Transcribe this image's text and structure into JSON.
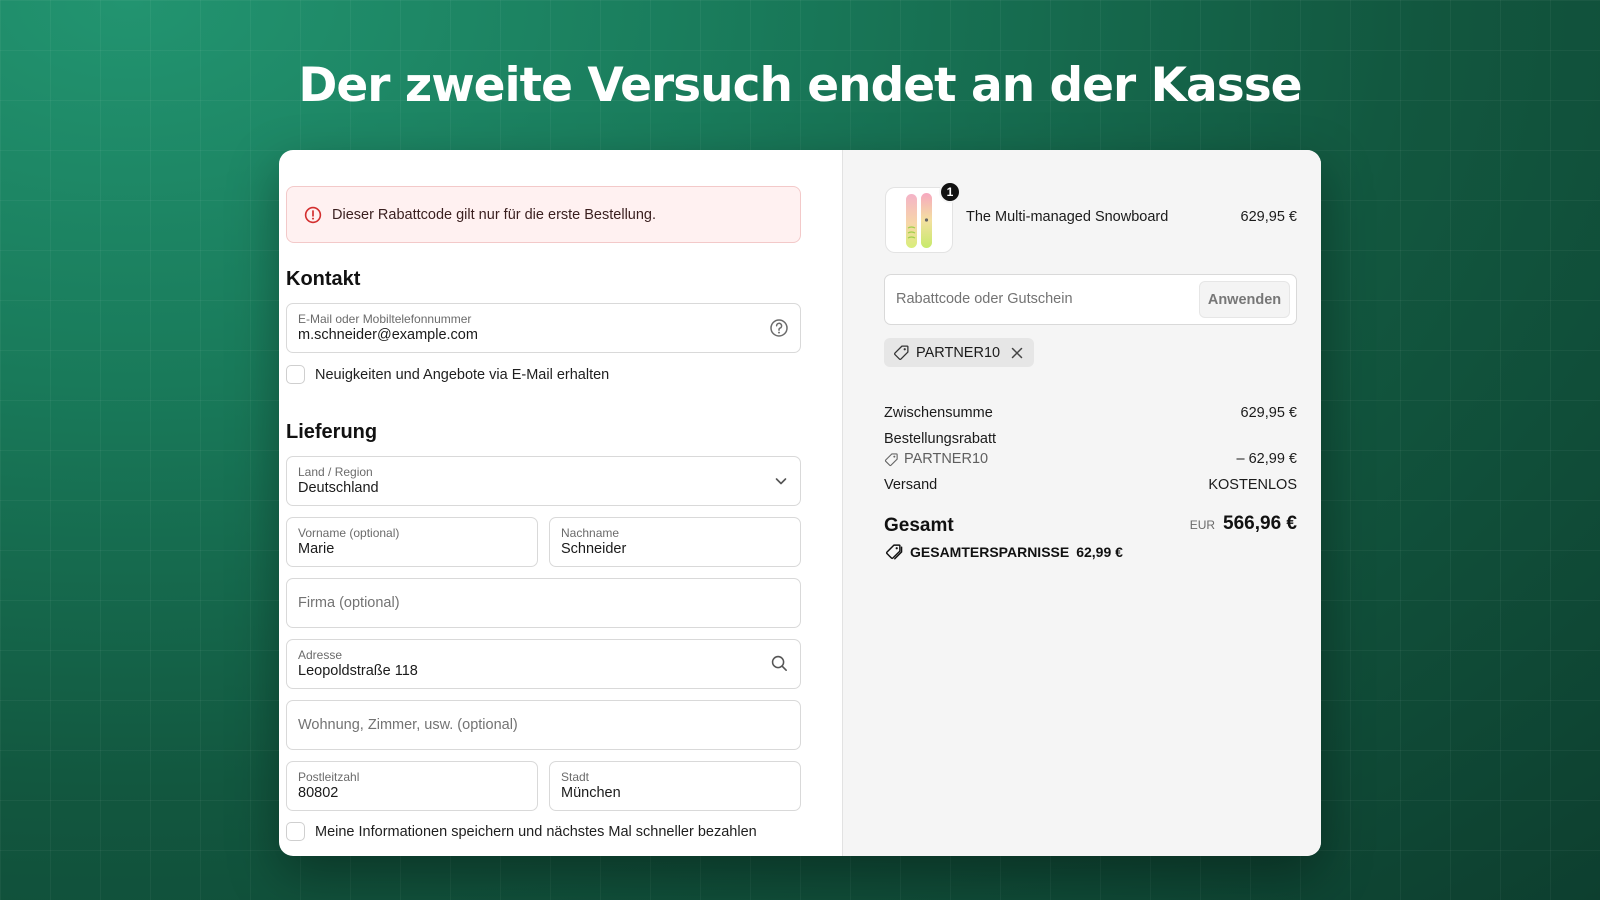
{
  "headline": "Der zweite Versuch endet an der Kasse",
  "alert": {
    "message": "Dieser Rabattcode gilt nur für die erste Bestellung.",
    "icon": "alert-circle-icon",
    "color": "#d32f2f"
  },
  "contact": {
    "title": "Kontakt",
    "email_label": "E-Mail oder Mobiltelefonnummer",
    "email_value": "m.schneider@example.com",
    "newsletter_label": "Neuigkeiten und Angebote via E-Mail erhalten"
  },
  "delivery": {
    "title": "Lieferung",
    "country_label": "Land / Region",
    "country_value": "Deutschland",
    "first_name_label": "Vorname (optional)",
    "first_name_value": "Marie",
    "last_name_label": "Nachname",
    "last_name_value": "Schneider",
    "company_placeholder": "Firma (optional)",
    "address_label": "Adresse",
    "address_value": "Leopoldstraße 118",
    "apartment_placeholder": "Wohnung, Zimmer, usw. (optional)",
    "postal_label": "Postleitzahl",
    "postal_value": "80802",
    "city_label": "Stadt",
    "city_value": "München",
    "save_info_label": "Meine Informationen speichern und nächstes Mal schneller bezahlen"
  },
  "summary": {
    "product": {
      "name": "The Multi-managed Snowboard",
      "price": "629,95 €",
      "quantity": "1"
    },
    "discount_placeholder": "Rabattcode oder Gutschein",
    "apply_label": "Anwenden",
    "applied_code": "PARTNER10",
    "subtotal_label": "Zwischensumme",
    "subtotal_value": "629,95 €",
    "order_discount_label": "Bestellungsrabatt",
    "order_discount_code": "PARTNER10",
    "order_discount_value": "– 62,99 €",
    "shipping_label": "Versand",
    "shipping_value": "KOSTENLOS",
    "total_label": "Gesamt",
    "total_currency": "EUR",
    "total_value": "566,96 €",
    "savings_label": "GESAMTERSPARNISSE",
    "savings_value": "62,99 €"
  }
}
